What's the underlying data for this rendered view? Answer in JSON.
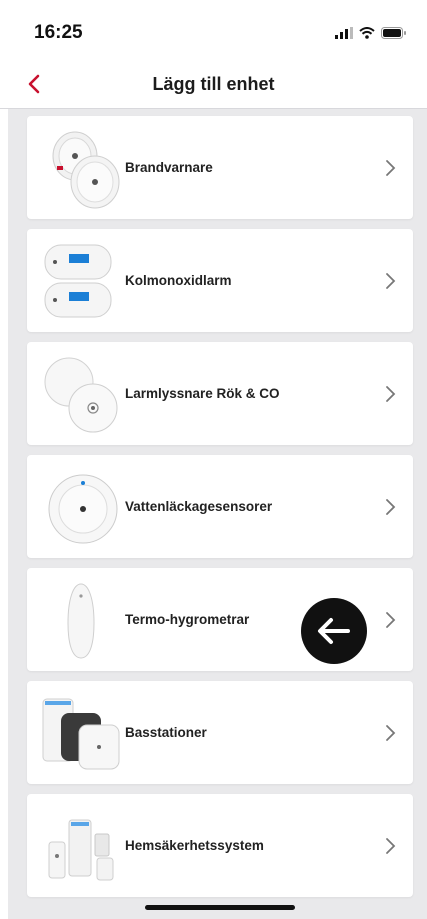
{
  "status_bar": {
    "time": "16:25",
    "icons": [
      "signal-icon",
      "wifi-icon",
      "battery-icon"
    ]
  },
  "nav": {
    "back_icon": "chevron-left-icon",
    "title": "Lägg till enhet"
  },
  "accent_color": "#c8102e",
  "items": [
    {
      "label": "Brandvarnare",
      "icon": "smoke-detector-icon"
    },
    {
      "label": "Kolmonoxidlarm",
      "icon": "co-alarm-icon"
    },
    {
      "label": "Larmlyssnare Rök & CO",
      "icon": "alarm-listener-icon"
    },
    {
      "label": "Vattenläckagesensorer",
      "icon": "water-leak-sensor-icon"
    },
    {
      "label": "Termo-hygrometrar",
      "icon": "thermo-hygrometer-icon"
    },
    {
      "label": "Basstationer",
      "icon": "base-station-icon"
    },
    {
      "label": "Hemsäkerhetssystem",
      "icon": "home-security-system-icon"
    }
  ],
  "overlay": {
    "icon": "arrow-left-icon"
  }
}
